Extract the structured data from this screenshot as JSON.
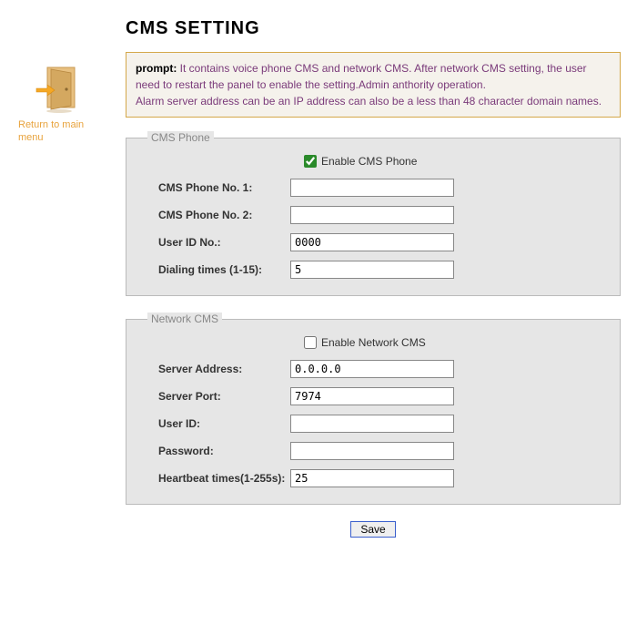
{
  "page": {
    "title": "CMS SETTING"
  },
  "sidebar": {
    "return_label": "Return to main menu"
  },
  "prompt": {
    "label": "prompt:",
    "text": " It contains voice phone CMS and network CMS. After network CMS setting, the user need to restart the panel to enable the setting.Admin anthority operation.\nAlarm server address can be an IP address can also be a less than 48 character domain names."
  },
  "cms_phone": {
    "legend": "CMS Phone",
    "enable_label": "Enable CMS Phone",
    "enable_checked": true,
    "fields": {
      "phone1": {
        "label": "CMS Phone No. 1:",
        "value": ""
      },
      "phone2": {
        "label": "CMS Phone No. 2:",
        "value": ""
      },
      "user_id": {
        "label": "User ID No.:",
        "value": "0000"
      },
      "dialing": {
        "label": "Dialing times (1-15):",
        "value": "5"
      }
    }
  },
  "network_cms": {
    "legend": "Network CMS",
    "enable_label": "Enable Network CMS",
    "enable_checked": false,
    "fields": {
      "server_address": {
        "label": "Server Address:",
        "value": "0.0.0.0"
      },
      "server_port": {
        "label": "Server Port:",
        "value": "7974"
      },
      "user_id": {
        "label": "User ID:",
        "value": ""
      },
      "password": {
        "label": "Password:",
        "value": ""
      },
      "heartbeat": {
        "label": "Heartbeat times(1-255s):",
        "value": "25"
      }
    }
  },
  "actions": {
    "save_label": "Save"
  }
}
